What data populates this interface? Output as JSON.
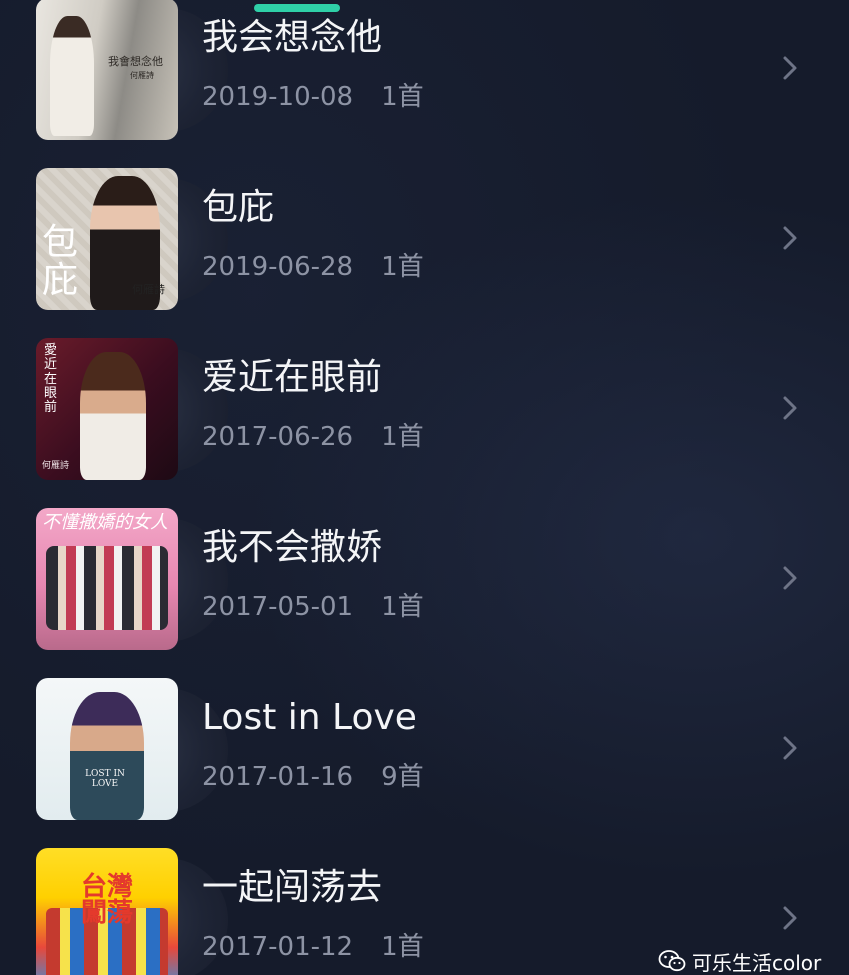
{
  "albums": [
    {
      "title": "我会想念他",
      "date": "2019-10-08",
      "count": "1首",
      "cover_text": "我會想念他",
      "cover_subtext": "何雁詩"
    },
    {
      "title": "包庇",
      "date": "2019-06-28",
      "count": "1首",
      "cover_text": "包庇",
      "cover_subtext": "何雁詩"
    },
    {
      "title": "爱近在眼前",
      "date": "2017-06-26",
      "count": "1首",
      "cover_text": "愛近在眼前",
      "cover_subtext": "何雁詩"
    },
    {
      "title": "我不会撒娇",
      "date": "2017-05-01",
      "count": "1首",
      "cover_text": "不懂撒嬌的女人",
      "cover_subtext": ""
    },
    {
      "title": "Lost in Love",
      "date": "2017-01-16",
      "count": "9首",
      "cover_text": "LOST IN LOVE",
      "cover_subtext": ""
    },
    {
      "title": "一起闯荡去",
      "date": "2017-01-12",
      "count": "1首",
      "cover_text": "台灣闖蕩",
      "cover_subtext": ""
    }
  ],
  "watermark": {
    "text": "可乐生活color",
    "icon": "wechat-icon"
  },
  "icons": {
    "row_arrow": "chevron-right-icon"
  },
  "colors": {
    "background": "#151b2b",
    "tab_indicator": "#2fd0a8",
    "title_text": "#f4f5f7",
    "meta_text": "#8d93a4",
    "chevron": "#6e7487"
  }
}
